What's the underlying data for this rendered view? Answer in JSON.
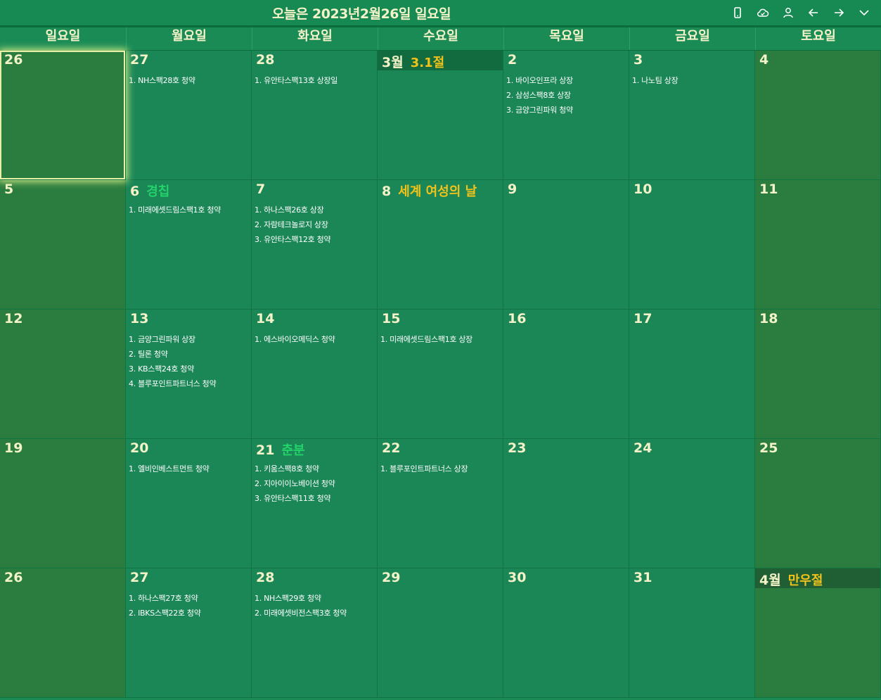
{
  "header": {
    "title": "오늘은 2023년2월26일 일요일",
    "icons": [
      "phone-icon",
      "cloud-sync-icon",
      "user-icon",
      "arrow-left-icon",
      "arrow-right-icon",
      "chevron-down-icon"
    ]
  },
  "colors": {
    "background": "#1b8757",
    "weekend": "#2b7d3f",
    "text": "#f4f2c8",
    "holiday_gold": "#f2c21a",
    "holiday_green": "#22d36a"
  },
  "weekdays": [
    "일요일",
    "월요일",
    "화요일",
    "수요일",
    "목요일",
    "금요일",
    "토요일"
  ],
  "weeks": [
    [
      {
        "day": "26",
        "today": true,
        "events": []
      },
      {
        "day": "27",
        "events": [
          "1. NH스팩28호 청약"
        ]
      },
      {
        "day": "28",
        "events": [
          "1. 유안타스팩13호 상장일"
        ]
      },
      {
        "day": "3월",
        "month_head": true,
        "holiday": "3.1절",
        "holiday_color": "gold",
        "events": []
      },
      {
        "day": "2",
        "events": [
          "1. 바이오인프라 상장",
          "2. 삼성스팩8호 상장",
          "3. 금양그린파워 청약"
        ]
      },
      {
        "day": "3",
        "events": [
          "1. 나노팀 상장"
        ]
      },
      {
        "day": "4",
        "events": []
      }
    ],
    [
      {
        "day": "5",
        "events": []
      },
      {
        "day": "6",
        "holiday": "경칩",
        "holiday_color": "green",
        "events": [
          "1. 미래에셋드림스팩1호 청약"
        ]
      },
      {
        "day": "7",
        "events": [
          "1. 하나스팩26호 상장",
          "2. 자람테크놀로지 상장",
          "3. 유안타스팩12호 청약"
        ]
      },
      {
        "day": "8",
        "holiday": "세계 여성의 날",
        "holiday_color": "gold",
        "events": []
      },
      {
        "day": "9",
        "events": []
      },
      {
        "day": "10",
        "events": []
      },
      {
        "day": "11",
        "events": []
      }
    ],
    [
      {
        "day": "12",
        "events": []
      },
      {
        "day": "13",
        "events": [
          "1. 금양그린파워 상장",
          "2. 틸론 청약",
          "3. KB스팩24호 청약",
          "4. 블루포인트파트너스 청약"
        ]
      },
      {
        "day": "14",
        "events": [
          "1. 에스바이오메딕스 청약"
        ]
      },
      {
        "day": "15",
        "events": [
          "1. 미래에셋드림스팩1호 상장"
        ]
      },
      {
        "day": "16",
        "events": []
      },
      {
        "day": "17",
        "events": []
      },
      {
        "day": "18",
        "events": []
      }
    ],
    [
      {
        "day": "19",
        "events": []
      },
      {
        "day": "20",
        "events": [
          "1. 엘비인베스트먼트 청약"
        ]
      },
      {
        "day": "21",
        "holiday": "춘분",
        "holiday_color": "green",
        "events": [
          "1. 키움스팩8호 청약",
          "2. 지아이이노베이션 청약",
          "3. 유안타스팩11호 청약"
        ]
      },
      {
        "day": "22",
        "events": [
          "1. 블루포인트파트너스 상장"
        ]
      },
      {
        "day": "23",
        "events": []
      },
      {
        "day": "24",
        "events": []
      },
      {
        "day": "25",
        "events": []
      }
    ],
    [
      {
        "day": "26",
        "events": []
      },
      {
        "day": "27",
        "events": [
          "1. 하나스팩27호 청약",
          "2. IBKS스팩22호 청약"
        ]
      },
      {
        "day": "28",
        "events": [
          "1. NH스팩29호 청약",
          "2. 미래에셋비전스팩3호 청약"
        ]
      },
      {
        "day": "29",
        "events": []
      },
      {
        "day": "30",
        "events": []
      },
      {
        "day": "31",
        "events": []
      },
      {
        "day": "4월",
        "month_head": true,
        "holiday": "만우절",
        "holiday_color": "gold",
        "events": []
      }
    ]
  ]
}
